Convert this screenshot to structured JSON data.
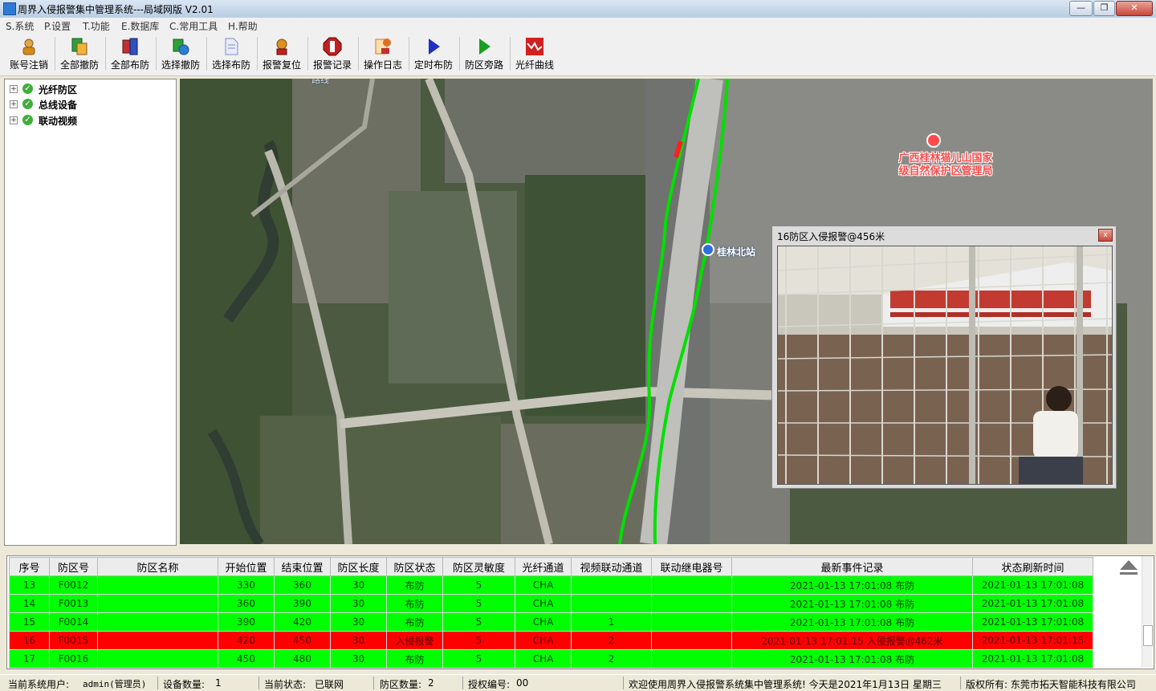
{
  "window": {
    "title": "周界入侵报警集中管理系统---局域网版 V2.01",
    "min": "—",
    "max": "❐",
    "close": "✕"
  },
  "menu": [
    "S.系统",
    "P.设置",
    "T.功能",
    "E.数据库",
    "C.常用工具",
    "H.帮助"
  ],
  "toolbar": [
    {
      "label": "账号注销",
      "icon": "user-logout-icon",
      "color": "#d48b1a"
    },
    {
      "label": "全部撤防",
      "icon": "disarm-all-icon",
      "color": "#2f9f3a"
    },
    {
      "label": "全部布防",
      "icon": "arm-all-icon",
      "color": "#c03030"
    },
    {
      "label": "选择撤防",
      "icon": "select-disarm-icon",
      "color": "#2f9f3a"
    },
    {
      "label": "选择布防",
      "icon": "select-arm-icon",
      "color": "#7e8cc9"
    },
    {
      "label": "报警复位",
      "icon": "alarm-reset-icon",
      "color": "#e09020"
    },
    {
      "label": "报警记录",
      "icon": "alarm-log-icon",
      "color": "#c02020"
    },
    {
      "label": "操作日志",
      "icon": "operation-log-icon",
      "color": "#e07020"
    },
    {
      "label": "定时布防",
      "icon": "timed-arm-icon",
      "color": "#2030c0"
    },
    {
      "label": "防区旁路",
      "icon": "zone-bypass-icon",
      "color": "#18a020"
    },
    {
      "label": "光纤曲线",
      "icon": "fiber-curve-icon",
      "color": "#d02020"
    }
  ],
  "tree": [
    {
      "label": "光纤防区",
      "expander": "+",
      "check": "✓"
    },
    {
      "label": "总线设备",
      "expander": "+",
      "check": "✓"
    },
    {
      "label": "联动视频",
      "expander": "+",
      "check": "✓"
    }
  ],
  "map": {
    "poi_label_line1": "广西桂林猫儿山国家",
    "poi_label_line2": "级自然保护区管理局",
    "station_label": "桂林北站",
    "top_label": "路线"
  },
  "popup": {
    "title": "16防区入侵报警@456米",
    "close": "x"
  },
  "table": {
    "headers": [
      "序号",
      "防区号",
      "防区名称",
      "开始位置",
      "结束位置",
      "防区长度",
      "防区状态",
      "防区灵敏度",
      "光纤通道",
      "视频联动通道",
      "联动继电器号",
      "最新事件记录",
      "状态刷新时间"
    ],
    "rows": [
      {
        "status": "ok",
        "cells": [
          "13",
          "F0012",
          "",
          "330",
          "360",
          "30",
          "布防",
          "5",
          "CHA",
          "",
          "",
          "2021-01-13 17:01:08 布防",
          "2021-01-13 17:01:08"
        ]
      },
      {
        "status": "ok",
        "cells": [
          "14",
          "F0013",
          "",
          "360",
          "390",
          "30",
          "布防",
          "5",
          "CHA",
          "",
          "",
          "2021-01-13 17:01:08 布防",
          "2021-01-13 17:01:08"
        ]
      },
      {
        "status": "ok",
        "cells": [
          "15",
          "F0014",
          "",
          "390",
          "420",
          "30",
          "布防",
          "5",
          "CHA",
          "1",
          "",
          "2021-01-13 17:01:08 布防",
          "2021-01-13 17:01:08"
        ]
      },
      {
        "status": "alarm",
        "cells": [
          "16",
          "F0015",
          "",
          "420",
          "450",
          "30",
          "入侵报警",
          "5",
          "CHA",
          "2",
          "",
          "2021-01-13 17:01:15  入侵报警@462米",
          "2021-01-13 17:01:15"
        ]
      },
      {
        "status": "ok",
        "cells": [
          "17",
          "F0016",
          "",
          "450",
          "480",
          "30",
          "布防",
          "5",
          "CHA",
          "2",
          "",
          "2021-01-13 17:01:08 布防",
          "2021-01-13 17:01:08"
        ]
      }
    ]
  },
  "statusbar": {
    "user_label": "当前系统用户:",
    "user_value": "admin(管理员)",
    "devices_label": "设备数量:",
    "devices_value": "1",
    "state_label": "当前状态:",
    "state_value": "已联网",
    "zones_label": "防区数量:",
    "zones_value": "2",
    "auth_label": "授权编号:",
    "auth_value": "00",
    "welcome": "欢迎使用周界入侵报警系统集中管理系统!  今天是2021年1月13日  星期三",
    "copyright": "版权所有: 东莞市拓天智能科技有限公司"
  }
}
